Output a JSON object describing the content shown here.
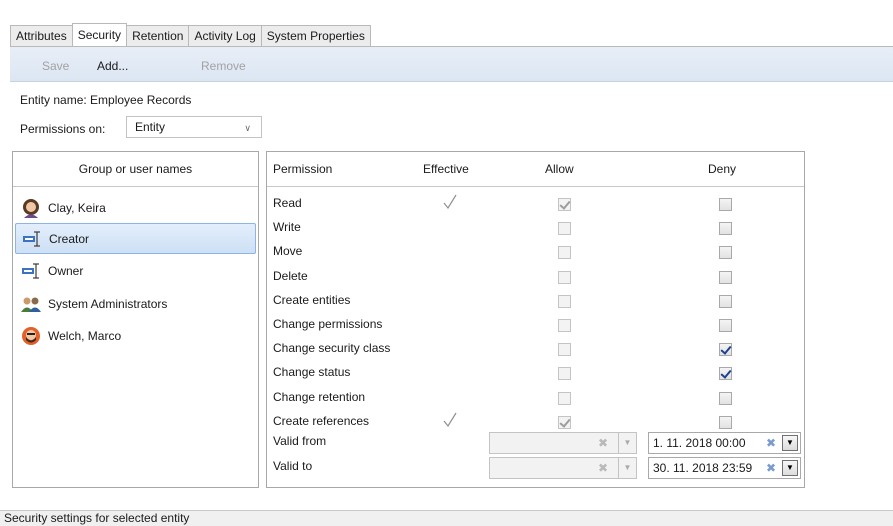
{
  "tabs": [
    {
      "label": "Attributes",
      "active": false
    },
    {
      "label": "Security",
      "active": true
    },
    {
      "label": "Retention",
      "active": false
    },
    {
      "label": "Activity Log",
      "active": false
    },
    {
      "label": "System Properties",
      "active": false
    }
  ],
  "toolbar": {
    "save_label": "Save",
    "add_label": "Add...",
    "remove_label": "Remove"
  },
  "entity": {
    "label": "Entity name:",
    "name": "Employee Records"
  },
  "permissions_on": {
    "label": "Permissions on:",
    "value": "Entity"
  },
  "users": {
    "header": "Group or user names",
    "items": [
      {
        "name": "Clay, Keira",
        "icon": "user-female-icon",
        "selected": false
      },
      {
        "name": "Creator",
        "icon": "role-icon",
        "selected": true
      },
      {
        "name": "Owner",
        "icon": "role-icon",
        "selected": false
      },
      {
        "name": "System Administrators",
        "icon": "group-icon",
        "selected": false
      },
      {
        "name": "Welch, Marco",
        "icon": "user-male-icon",
        "selected": false
      }
    ]
  },
  "permissions": {
    "headers": {
      "permission": "Permission",
      "effective": "Effective",
      "allow": "Allow",
      "deny": "Deny"
    },
    "rows": [
      {
        "label": "Read",
        "effective": true,
        "allow": true,
        "allow_disabled": true,
        "deny": false
      },
      {
        "label": "Write",
        "effective": false,
        "allow": false,
        "allow_disabled": true,
        "deny": false
      },
      {
        "label": "Move",
        "effective": false,
        "allow": false,
        "allow_disabled": true,
        "deny": false
      },
      {
        "label": "Delete",
        "effective": false,
        "allow": false,
        "allow_disabled": true,
        "deny": false
      },
      {
        "label": "Create entities",
        "effective": false,
        "allow": false,
        "allow_disabled": true,
        "deny": false
      },
      {
        "label": "Change permissions",
        "effective": false,
        "allow": false,
        "allow_disabled": true,
        "deny": false
      },
      {
        "label": "Change security class",
        "effective": false,
        "allow": false,
        "allow_disabled": true,
        "deny": true
      },
      {
        "label": "Change status",
        "effective": false,
        "allow": false,
        "allow_disabled": true,
        "deny": true
      },
      {
        "label": "Change retention",
        "effective": false,
        "allow": false,
        "allow_disabled": true,
        "deny": false
      },
      {
        "label": "Create references",
        "effective": true,
        "allow": true,
        "allow_disabled": true,
        "deny": false
      }
    ],
    "valid_from": {
      "label": "Valid from",
      "allow_value": "",
      "deny_value": "1. 11. 2018 00:00"
    },
    "valid_to": {
      "label": "Valid to",
      "allow_value": "",
      "deny_value": "30. 11. 2018 23:59"
    }
  },
  "status": "Security settings for selected entity",
  "colors": {
    "selection": "#cde0f5",
    "check": "#1f3f8f",
    "toolbar": "#dce6f3"
  }
}
